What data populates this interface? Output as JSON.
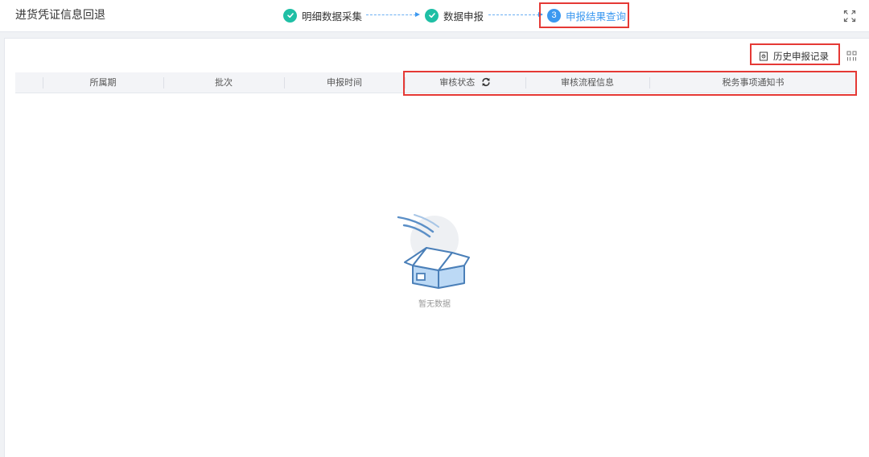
{
  "header": {
    "title": "进货凭证信息回退",
    "steps": [
      {
        "label": "明细数据采集",
        "state": "done"
      },
      {
        "label": "数据申报",
        "state": "done"
      },
      {
        "label": "申报结果查询",
        "state": "active",
        "number": "3"
      }
    ]
  },
  "toolbar": {
    "history_label": "历史申报记录"
  },
  "table": {
    "columns": [
      "所属期",
      "批次",
      "申报时间",
      "审核状态",
      "审核流程信息",
      "税务事项通知书"
    ]
  },
  "empty_state": {
    "text": "暂无数据"
  },
  "colors": {
    "done": "#1fbfa5",
    "active": "#3c99f0",
    "highlight": "#e53935"
  }
}
